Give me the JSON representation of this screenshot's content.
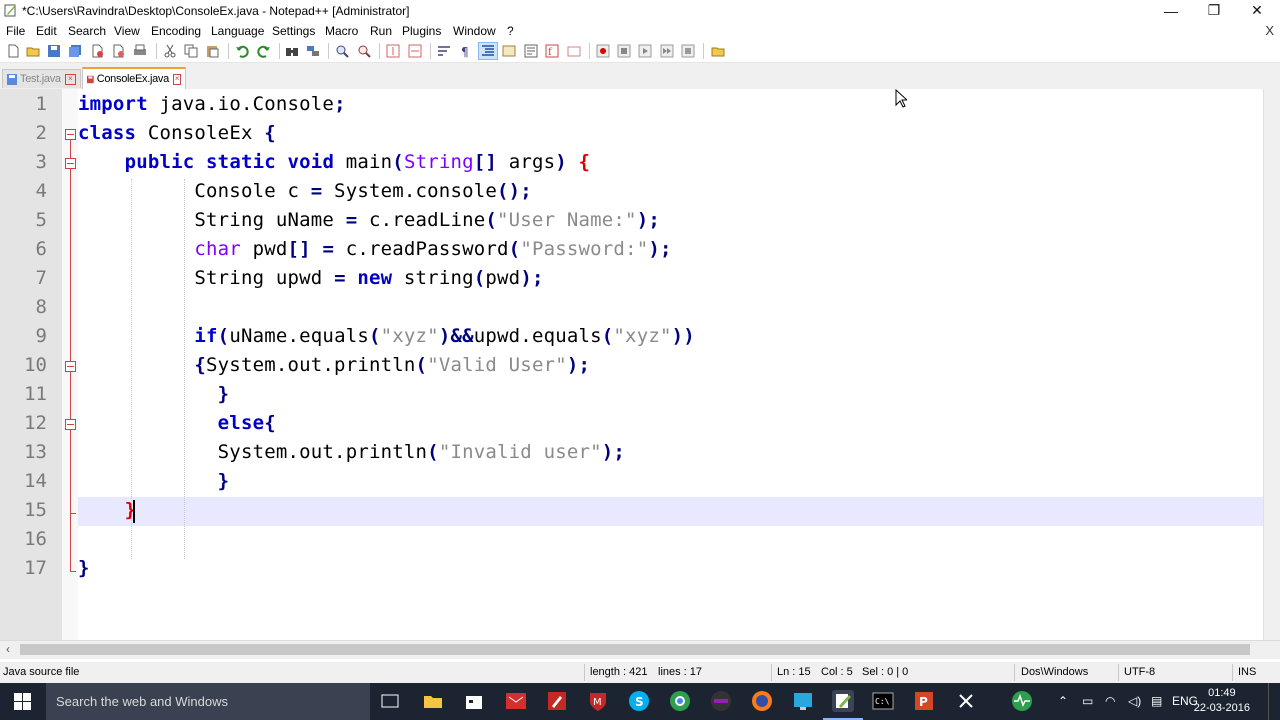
{
  "window": {
    "title": "*C:\\Users\\Ravindra\\Desktop\\ConsoleEx.java - Notepad++ [Administrator]",
    "minimize": "—",
    "restore": "❐",
    "close": "✕"
  },
  "menu": {
    "items": [
      "File",
      "Edit",
      "Search",
      "View",
      "Encoding",
      "Language",
      "Settings",
      "Macro",
      "Run",
      "Plugins",
      "Window",
      "?"
    ],
    "close_doc": "X"
  },
  "tabs": [
    {
      "label": "Test.java",
      "active": false
    },
    {
      "label": "ConsoleEx.java",
      "active": true
    }
  ],
  "editor": {
    "line_numbers": [
      "1",
      "2",
      "3",
      "4",
      "5",
      "6",
      "7",
      "8",
      "9",
      "10",
      "11",
      "12",
      "13",
      "14",
      "15",
      "16",
      "17"
    ],
    "current_line": 15,
    "lines": [
      "import java.io.Console;",
      "class ConsoleEx {",
      "    public static void main(String[] args) {",
      "          Console c = System.console();",
      "          String uName = c.readLine(\"User Name:\");",
      "          char pwd[] = c.readPassword(\"Password:\");",
      "          String upwd = new string(pwd);",
      "",
      "          if(uName.equals(\"xyz\")&&upwd.equals(\"xyz\"))",
      "          {System.out.println(\"Valid User\");",
      "            }",
      "            else{",
      "            System.out.println(\"Invalid user\");",
      "            }",
      "    }",
      "",
      "}"
    ]
  },
  "statusbar": {
    "file_type": "Java source file",
    "length": "length : 421",
    "lines": "lines : 17",
    "ln": "Ln : 15",
    "col": "Col : 5",
    "sel": "Sel : 0 | 0",
    "eol": "Dos\\Windows",
    "encoding": "UTF-8",
    "mode": "INS"
  },
  "taskbar": {
    "search_placeholder": "Search the web and Windows",
    "language": "ENG",
    "time": "01:49",
    "date": "22-03-2016"
  },
  "colors": {
    "keyword": "#0000c8",
    "type": "#8000ff",
    "string": "#8a8a8a",
    "operator": "#000080",
    "brace_match": "#e00000",
    "current_line": "#e8e8ff"
  }
}
